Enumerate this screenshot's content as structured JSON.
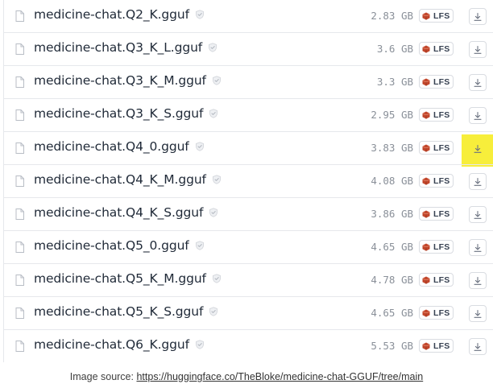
{
  "files": [
    {
      "name": "medicine-chat.Q2_K.gguf",
      "size": "2.83 GB",
      "lfs": "LFS"
    },
    {
      "name": "medicine-chat.Q3_K_L.gguf",
      "size": "3.6 GB",
      "lfs": "LFS"
    },
    {
      "name": "medicine-chat.Q3_K_M.gguf",
      "size": "3.3 GB",
      "lfs": "LFS"
    },
    {
      "name": "medicine-chat.Q3_K_S.gguf",
      "size": "2.95 GB",
      "lfs": "LFS"
    },
    {
      "name": "medicine-chat.Q4_0.gguf",
      "size": "3.83 GB",
      "lfs": "LFS",
      "highlighted": true
    },
    {
      "name": "medicine-chat.Q4_K_M.gguf",
      "size": "4.08 GB",
      "lfs": "LFS"
    },
    {
      "name": "medicine-chat.Q4_K_S.gguf",
      "size": "3.86 GB",
      "lfs": "LFS"
    },
    {
      "name": "medicine-chat.Q5_0.gguf",
      "size": "4.65 GB",
      "lfs": "LFS"
    },
    {
      "name": "medicine-chat.Q5_K_M.gguf",
      "size": "4.78 GB",
      "lfs": "LFS"
    },
    {
      "name": "medicine-chat.Q5_K_S.gguf",
      "size": "4.65 GB",
      "lfs": "LFS"
    },
    {
      "name": "medicine-chat.Q6_K.gguf",
      "size": "5.53 GB",
      "lfs": "LFS"
    }
  ],
  "icons": {
    "file": "file-icon",
    "verified": "shield-check-icon",
    "lfs": "lfs-cube-icon",
    "download": "download-icon"
  },
  "colors": {
    "highlight": "#f7ee3b",
    "lfs_icon": "#c2462b",
    "size_text": "#8a9099"
  },
  "caption": {
    "prefix": "Image source: ",
    "link": "https://huggingface.co/TheBloke/medicine-chat-GGUF/tree/main"
  }
}
